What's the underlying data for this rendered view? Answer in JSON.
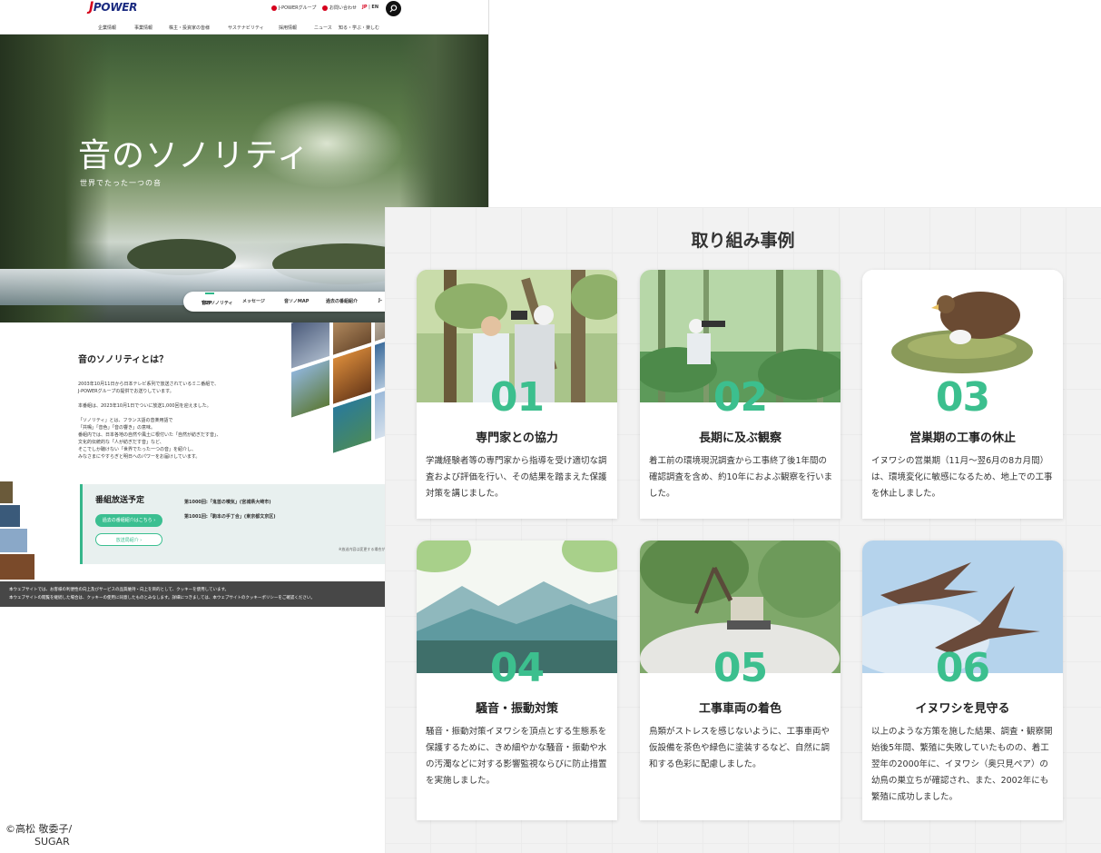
{
  "site": {
    "logo": "POWER",
    "logo_mark": "J",
    "util_group": "J-POWERグループ",
    "util_contact": "お問い合わせ",
    "lang_jp": "JP",
    "lang_sep": "|",
    "lang_en": "EN",
    "gnav": [
      "企業情報",
      "事業情報",
      "株主・投資家の皆様",
      "サステナビリティ",
      "採用情報",
      "ニュース",
      "知る・学ぶ・楽しむ"
    ],
    "hero_title": "音のソノリティ",
    "hero_subtitle": "世界でたった一つの音",
    "subnav": [
      {
        "label": "音のソノリティ\nTOP",
        "line1": "音のソノリティ",
        "line2": "TOP"
      },
      {
        "label": "メッセージ"
      },
      {
        "label": "音ソノMAP"
      },
      {
        "label": "過去の番組紹介"
      },
      {
        "label": "J-"
      }
    ],
    "about_title": "音のソノリティとは？",
    "about_p1a": "2003年10月11日から日本テレビ系列で放送されているミニ番組で、",
    "about_p1b": "J-POWERグループの提供でお送りしています。",
    "about_p2": "本番組は、2023年10月1日でついに放送1,000回を迎えました。",
    "about_p3": [
      "「ソノリティ」とは、フランス語の音楽用語で",
      "「共鳴」「音色」「音の響き」の意味。",
      "番組内では、日本各地の自然や風土に根付いた「自然が紡ぎだす音」、",
      "文化的伝統的な「人が紡ぎだす音」など、",
      "そこでしか聴けない「世界でたった一つの音」を紹介し、",
      "みなさまにやすらぎと明日へのパワーをお届けしています。"
    ],
    "broadcast_title": "番組放送予定",
    "broadcast_btn_past": "過去の番組紹介はこちら",
    "broadcast_btn_station": "放送局紹介",
    "episode1": "第1000回:「鬼首の噴気」(宮城県大崎市)",
    "episode2": "第1001回:「駒本の手丁合」(東京都文京区)",
    "broadcast_note": "※放送内容は変更する場合があ",
    "cookie_line1": "本ウェブサイトでは、お客様の利便性の向上及びサービスの品質維持・向上を目的として、クッキーを使用しています。",
    "cookie_line2": "本ウェブサイトの閲覧を継続した場合は、クッキーの使用に同意したものとみなします。詳細につきましては、本ウェブサイトのクッキーポリシーをご確認ください。"
  },
  "cases": {
    "title": "取り組み事例",
    "items": [
      {
        "num": "01",
        "title": "専門家との協力",
        "desc": "学識経験者等の専門家から指導を受け適切な調査および評価を行い、その結果を踏まえた保護対策を講じました。"
      },
      {
        "num": "02",
        "title": "長期に及ぶ観察",
        "desc": "着工前の環境現況調査から工事終了後1年間の確認調査を含め、約10年におよぶ観察を行いました。"
      },
      {
        "num": "03",
        "title": "営巣期の工事の休止",
        "desc": "イヌワシの営巣期（11月〜翌6月の8カ月間）は、環境変化に敏感になるため、地上での工事を休止しました。"
      },
      {
        "num": "04",
        "title": "騒音・振動対策",
        "desc": "騒音・振動対策イヌワシを頂点とする生態系を保護するために、きめ細やかな騒音・振動や水の汚濁などに対する影響監視ならびに防止措置を実施しました。"
      },
      {
        "num": "05",
        "title": "工事車両の着色",
        "desc": "鳥類がストレスを感じないように、工事車両や仮設備を茶色や緑色に塗装するなど、自然に調和する色彩に配慮しました。"
      },
      {
        "num": "06",
        "title": "イヌワシを見守る",
        "desc": "以上のような方策を施した結果、調査・観察開始後5年間、繁殖に失敗していたものの、着工翌年の2000年に、イヌワシ（奥只見ペア）の幼鳥の巣立ちが確認され、また、2002年にも繁殖に成功しました。"
      }
    ]
  },
  "credit_line1": "©高松 敬委子/",
  "credit_line2": "SUGAR",
  "colors": {
    "accent": "#3cbf8e",
    "brand_red": "#d6001c",
    "brand_navy": "#1a2a80"
  }
}
